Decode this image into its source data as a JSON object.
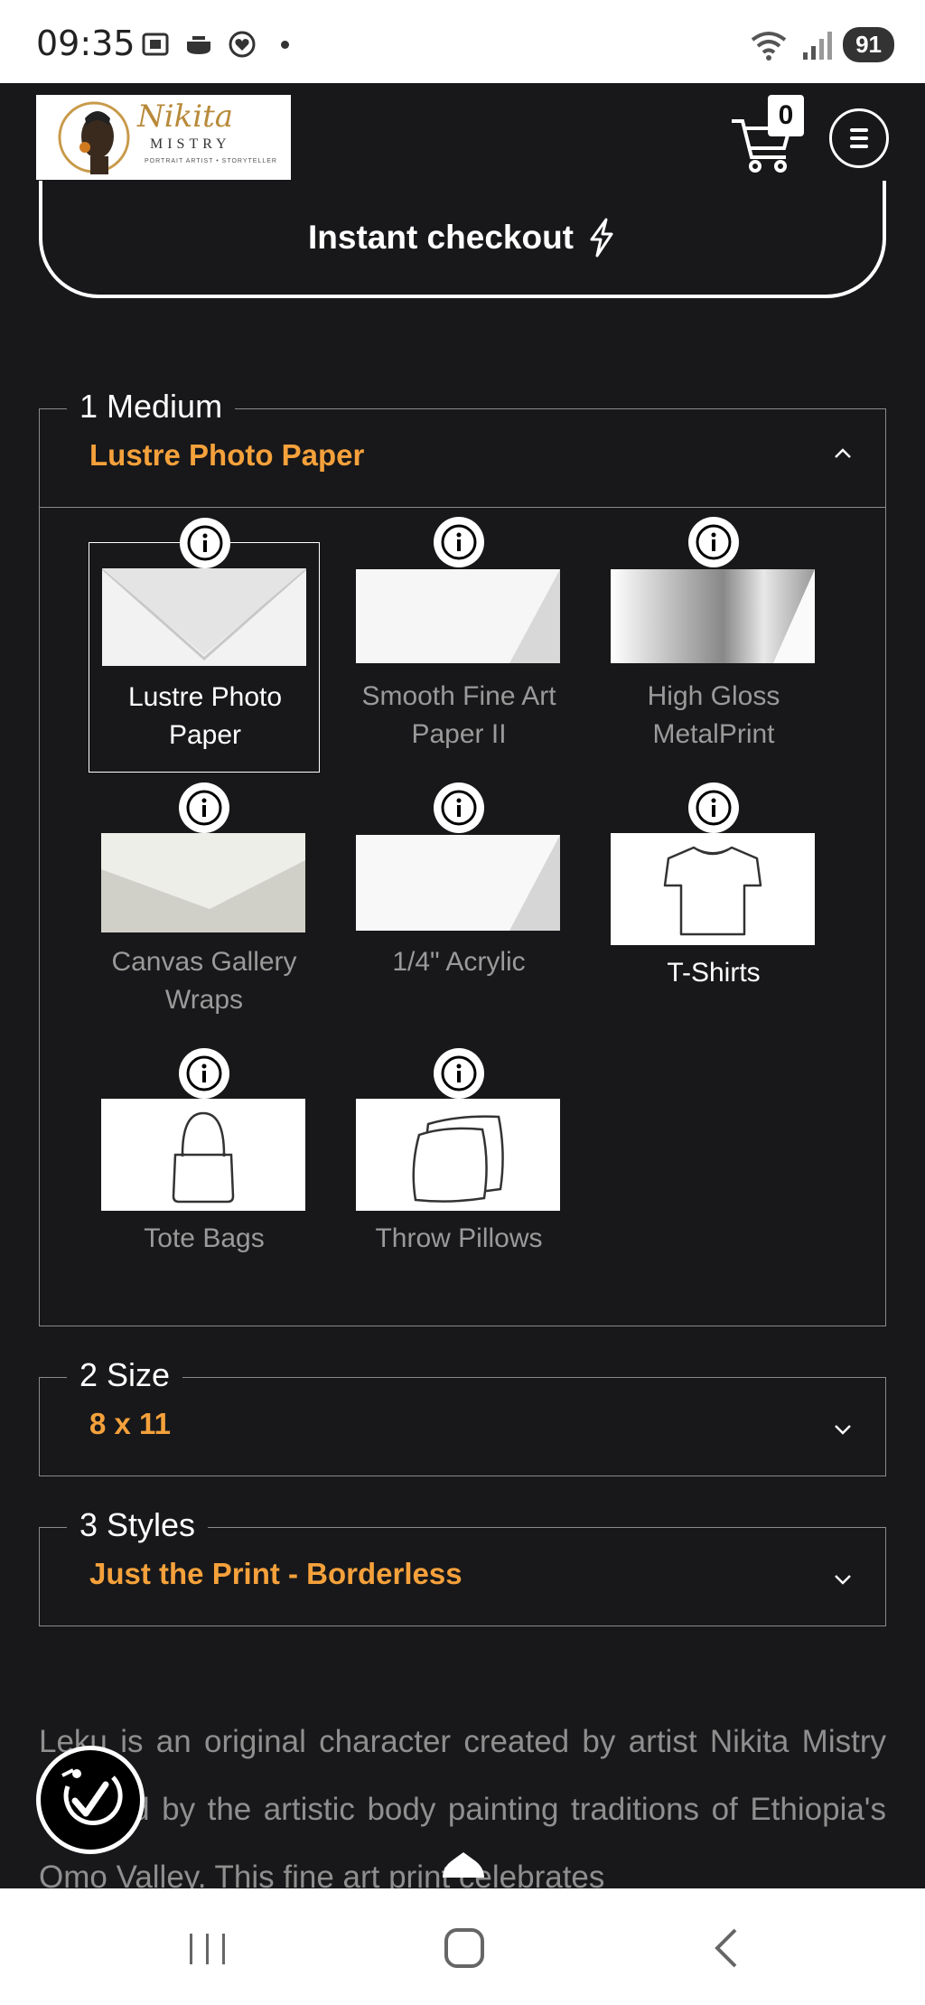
{
  "status_bar": {
    "time": "09:35",
    "battery": "91",
    "icons": [
      "screenshot-icon",
      "pot-icon",
      "heart-badge-icon",
      "wifi-icon",
      "signal-icon"
    ]
  },
  "header": {
    "logo": {
      "name": "Nikita",
      "sub": "MISTRY",
      "tagline": "PORTRAIT ARTIST • STORYTELLER"
    },
    "cart_count": "0"
  },
  "checkout": {
    "label": "Instant checkout"
  },
  "medium": {
    "legend": "1 Medium",
    "selected": "Lustre Photo Paper",
    "options": [
      {
        "label": "Lustre Photo Paper",
        "selected": true
      },
      {
        "label": "Smooth Fine Art Paper II",
        "selected": false
      },
      {
        "label": "High Gloss MetalPrint",
        "selected": false
      },
      {
        "label": "Canvas Gallery Wraps",
        "selected": false
      },
      {
        "label": "1/4\" Acrylic",
        "selected": false
      },
      {
        "label": "T-Shirts",
        "selected": false
      },
      {
        "label": "Tote Bags",
        "selected": false
      },
      {
        "label": "Throw Pillows",
        "selected": false
      }
    ]
  },
  "size": {
    "legend": "2 Size",
    "selected": "8 x 11"
  },
  "styles": {
    "legend": "3 Styles",
    "selected": "Just the Print - Borderless"
  },
  "description": "Leku is an original character created by artist Nikita Mistry inspired by the artistic body painting traditions of Ethiopia's Omo Valley. This fine art print celebrates",
  "colors": {
    "accent": "#f5a13b",
    "background": "#18181a"
  }
}
